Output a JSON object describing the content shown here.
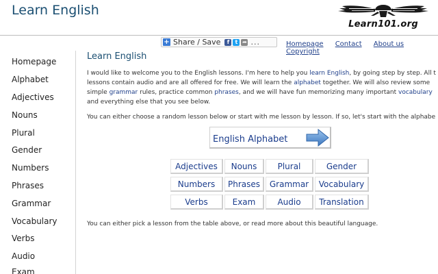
{
  "header": {
    "site_title": "Learn English",
    "logo_text": "Learn101.org"
  },
  "share": {
    "label": "Share / Save",
    "fb": "f",
    "tw": "t",
    "more": "..."
  },
  "topnav": [
    "Homepage",
    "Contact",
    "About us",
    "Copyright"
  ],
  "sidebar": [
    "Homepage",
    "Alphabet",
    "Adjectives",
    "Nouns",
    "Plural",
    "Gender",
    "Numbers",
    "Phrases",
    "Grammar",
    "Vocabulary",
    "Verbs",
    "Audio",
    "Exam"
  ],
  "main": {
    "title": "Learn English",
    "p1_line1_a": "I would like to welcome you to the English lessons. I'm here to help you ",
    "p1_link1": "learn English",
    "p1_line1_b": ", by going step by step. All t",
    "p1_line2_a": "lessons contain audio and are all offered for free. We will learn the ",
    "p1_link2": "alphabet",
    "p1_line2_b": " together. We will also review some",
    "p1_line3_a": "simple ",
    "p1_link3": "grammar",
    "p1_line3_b": " rules, practice common ",
    "p1_link4": "phrases",
    "p1_line3_c": ", and we will have fun memorizing many important ",
    "p1_link5": "vocabulary",
    "p1_line4": "and everything else that you see below.",
    "p2": "You can either choose a random lesson below or start with me lesson by lesson. If so, let's start with the alphabe",
    "alphabet_button": "English Alphabet",
    "footer": "You can either pick a lesson from the table above, or read more about this beautiful language."
  },
  "lessons": [
    [
      "Adjectives",
      "Nouns",
      "Plural",
      "Gender"
    ],
    [
      "Numbers",
      "Phrases",
      "Grammar",
      "Vocabulary"
    ],
    [
      "Verbs",
      "Exam",
      "Audio",
      "Translation"
    ]
  ],
  "colors": {
    "title_blue": "#1b4f72",
    "link_blue": "#1a3c8c",
    "arrow_blue": "#4a86c8"
  }
}
